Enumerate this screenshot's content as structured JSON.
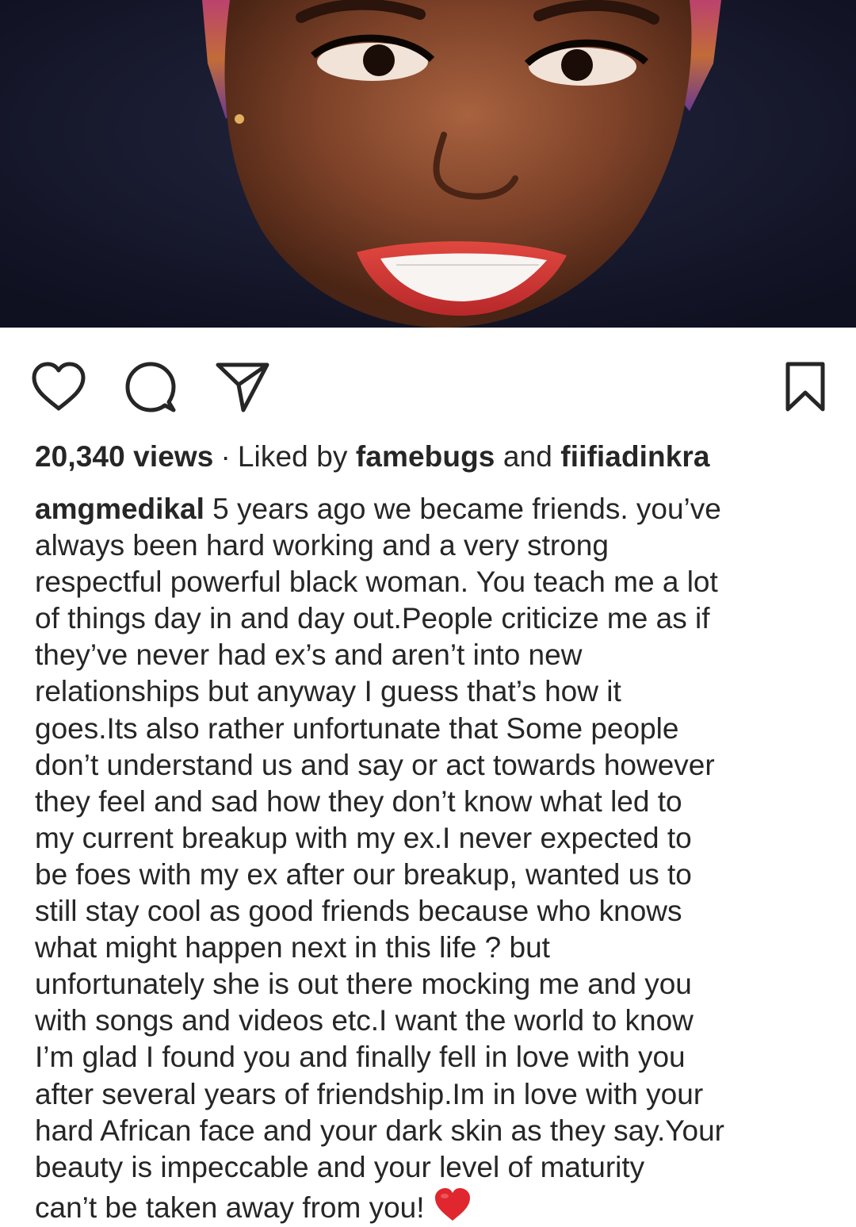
{
  "post": {
    "views_count": "20,340 views",
    "separator": "·",
    "liked_by_prefix": "Liked by",
    "liked_by_user_1": "famebugs",
    "liked_by_conjunction": "and",
    "liked_by_user_2": "fiifiadinkra",
    "caption_username": "amgmedikal",
    "caption_lines": [
      "5 years ago we became friends. you’ve",
      "always been hard working and a very strong",
      "respectful powerful black woman. You teach me a lot",
      "of things day in and day out.People criticize me as if",
      "they’ve never had ex’s and aren’t into new",
      "relationships but anyway I guess that’s how it",
      "goes.Its also rather unfortunate that Some people",
      "don’t understand us and say or act towards however",
      "they feel and  sad how they don’t know what led to",
      "my current breakup with my ex.I never expected to",
      "be foes with my ex after our breakup, wanted us to",
      "still stay cool as good friends because who knows",
      "what might happen next in this life ? but",
      "unfortunately she is out there mocking me and you",
      "with songs and videos etc.I want the world to know",
      "I’m glad I found you and finally fell in love with you",
      "after several years of friendship.Im in love with your",
      "hard African face and your dark skin as they say.Your",
      "beauty is impeccable and your  level of  maturity",
      "can’t be taken away from you!"
    ],
    "caption_emoji": "red-heart-emoji"
  },
  "icons": {
    "like": "heart-outline-icon",
    "comment": "comment-bubble-icon",
    "share": "paper-plane-icon",
    "save": "bookmark-icon"
  },
  "colors": {
    "text": "#262626",
    "background": "#ffffff",
    "photo_background": "#16182a",
    "heart_emoji": "#e0262e"
  }
}
